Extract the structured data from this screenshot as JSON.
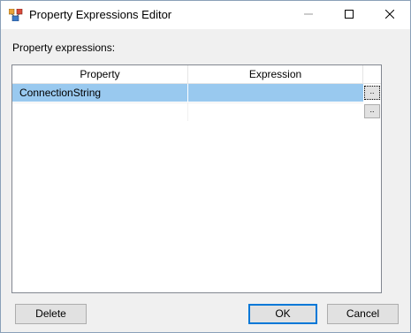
{
  "window": {
    "title": "Property Expressions Editor",
    "accent_color": "#0078d7"
  },
  "titlebar": {
    "app_icon": "ssis-package-icon",
    "minimize_icon": "minimize-icon",
    "maximize_icon": "maximize-icon",
    "close_icon": "close-icon"
  },
  "main": {
    "label": "Property expressions:",
    "grid": {
      "columns": [
        "Property",
        "Expression"
      ],
      "rows": [
        {
          "property": "ConnectionString",
          "expression": "",
          "button": "..",
          "selected": true
        },
        {
          "property": "",
          "expression": "",
          "button": "..",
          "selected": false
        }
      ],
      "selected_row_color": "#99c9ef"
    }
  },
  "buttons": {
    "delete": "Delete",
    "ok": "OK",
    "cancel": "Cancel"
  }
}
